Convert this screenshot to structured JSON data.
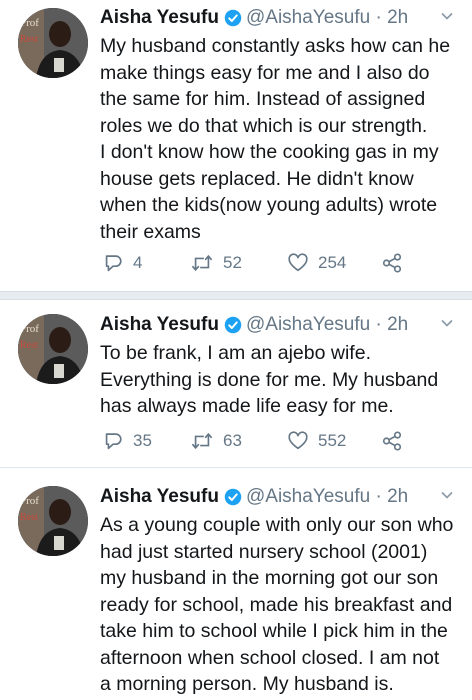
{
  "tweets": [
    {
      "author": "Aisha Yesufu",
      "handle": "@AishaYesufu",
      "time": "2h",
      "lines": [
        "My husband constantly asks how can he",
        "make things easy for me and I also do",
        "the same for him. Instead of assigned",
        "roles we do that which is our strength.",
        "I don't know how the cooking gas in my",
        "house gets replaced. He didn't know",
        "when the kids(now young adults) wrote",
        "their exams"
      ],
      "replies": "4",
      "retweets": "52",
      "likes": "254"
    },
    {
      "author": "Aisha Yesufu",
      "handle": "@AishaYesufu",
      "time": "2h",
      "lines": [
        "To be frank, I am an ajebo wife.",
        "Everything is done for me. My husband",
        "has always made life easy for me."
      ],
      "replies": "35",
      "retweets": "63",
      "likes": "552"
    },
    {
      "author": "Aisha Yesufu",
      "handle": "@AishaYesufu",
      "time": "2h",
      "lines": [
        "As a young couple with only our son who",
        "had just started nursery school (2001)",
        "my husband in the morning got our son",
        "ready for school, made his breakfast and",
        "take him to school while I pick him in the",
        "afternoon when school closed. I am not",
        "a morning person. My husband is."
      ]
    }
  ],
  "colors": {
    "verified": "#1da1f2",
    "secondary_text": "#657786",
    "primary_text": "#14171a",
    "gap": "#e6ecf0"
  },
  "icons": [
    "verified-badge-icon",
    "chevron-down-icon",
    "reply-icon",
    "retweet-icon",
    "like-icon",
    "share-icon"
  ]
}
